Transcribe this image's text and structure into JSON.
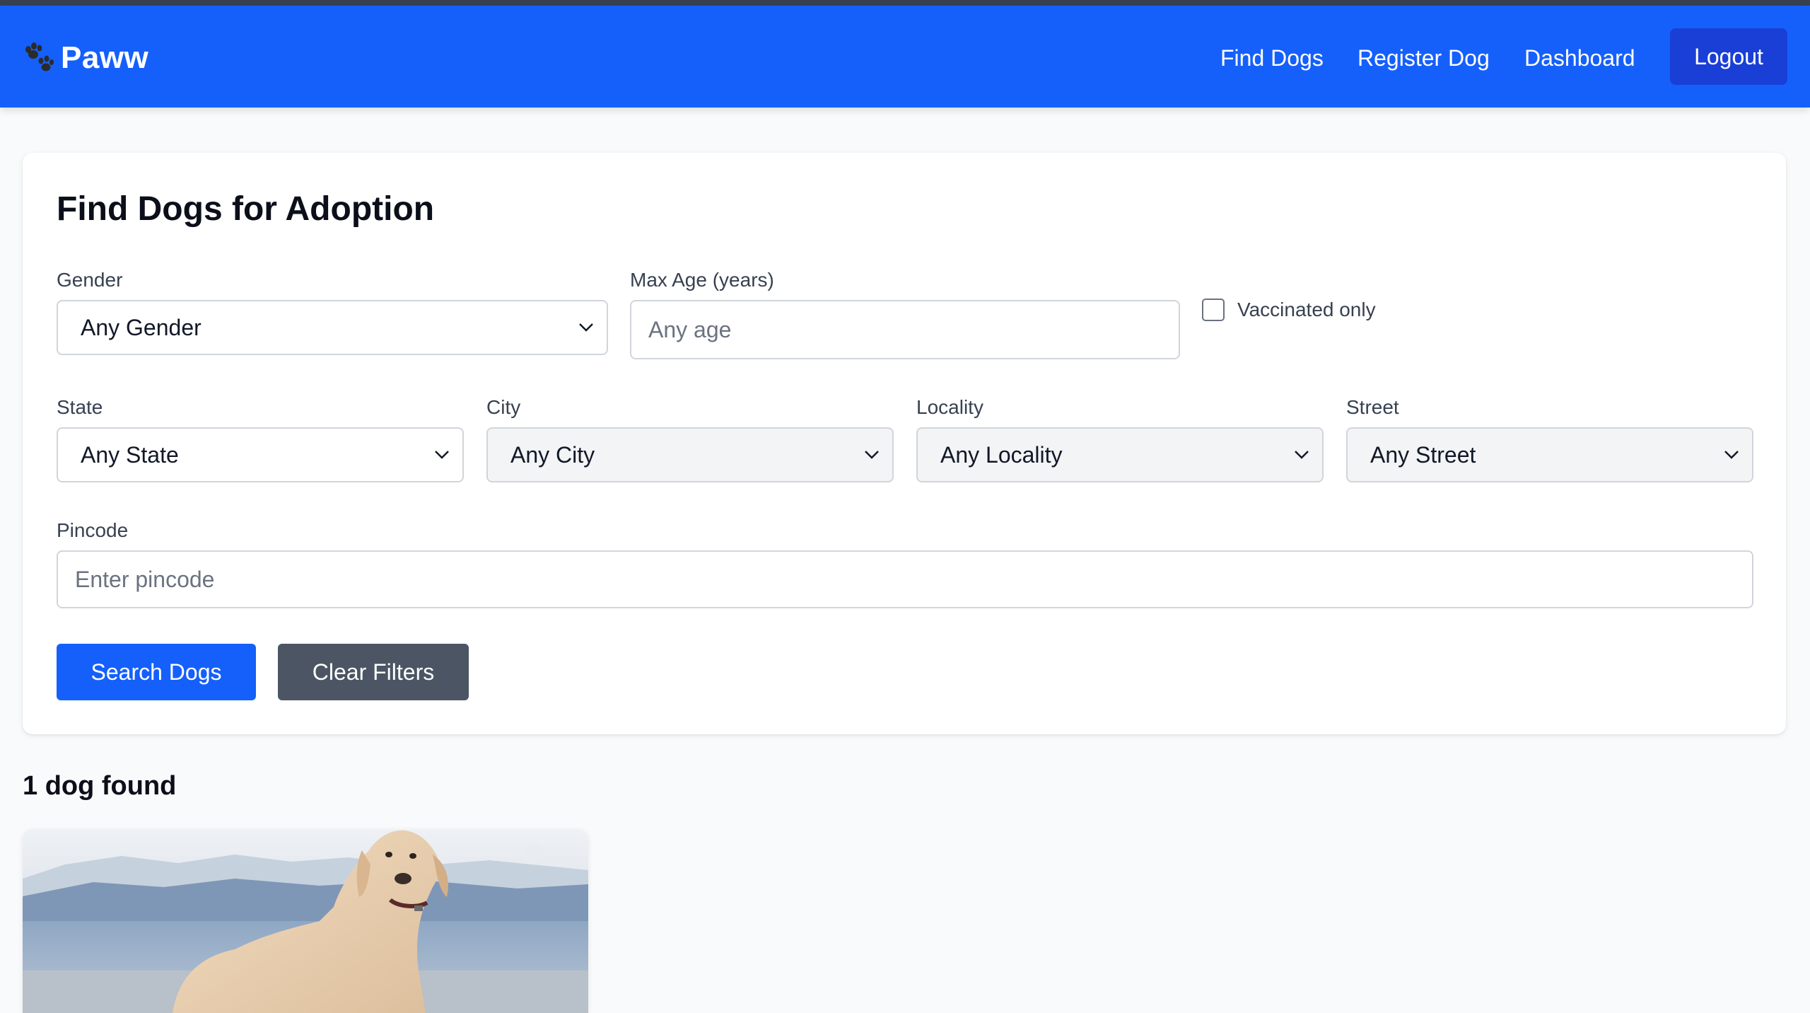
{
  "nav": {
    "brand": "Paww",
    "links": [
      "Find Dogs",
      "Register Dog",
      "Dashboard"
    ],
    "logout": "Logout"
  },
  "filters": {
    "title": "Find Dogs for Adoption",
    "gender": {
      "label": "Gender",
      "value": "Any Gender"
    },
    "max_age": {
      "label": "Max Age (years)",
      "placeholder": "Any age"
    },
    "vaccinated": {
      "label": "Vaccinated only",
      "checked": false
    },
    "state": {
      "label": "State",
      "value": "Any State"
    },
    "city": {
      "label": "City",
      "value": "Any City"
    },
    "locality": {
      "label": "Locality",
      "value": "Any Locality"
    },
    "street": {
      "label": "Street",
      "value": "Any Street"
    },
    "pincode": {
      "label": "Pincode",
      "placeholder": "Enter pincode"
    },
    "search_button": "Search Dogs",
    "clear_button": "Clear Filters"
  },
  "results": {
    "count_text": "1 dog found"
  },
  "colors": {
    "primary": "#1560fb",
    "logout_bg": "#1a3fd6",
    "secondary_button": "#4b5563",
    "page_bg": "#f9fafb"
  }
}
